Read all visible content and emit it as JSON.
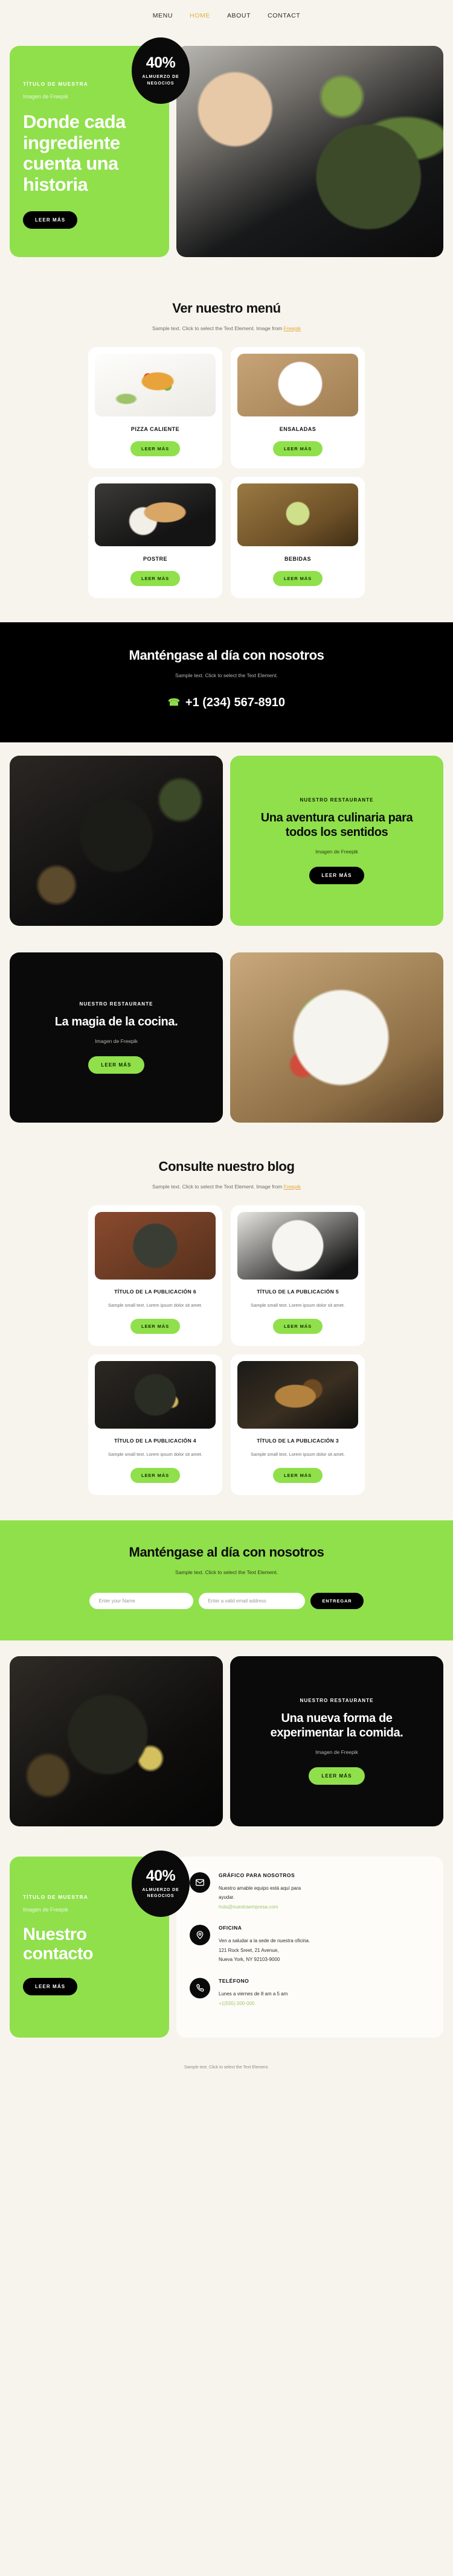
{
  "nav": {
    "items": [
      {
        "label": "MENU",
        "active": false
      },
      {
        "label": "HOME",
        "active": true
      },
      {
        "label": "ABOUT",
        "active": false
      },
      {
        "label": "CONTACT",
        "active": false
      }
    ]
  },
  "colors": {
    "lime": "#8fe04b",
    "black": "#000000",
    "cream": "#f7f4ed",
    "accent_gold": "#e2a93c",
    "accent_green_text": "#9fc765"
  },
  "hero": {
    "eyebrow": "TÍTULO DE MUESTRA",
    "subtitle": "Imagen de Freepik",
    "heading": "Donde cada ingrediente cuenta una historia",
    "button": "LEER MÁS",
    "badge": {
      "percent": "40%",
      "label": "ALMUERZO DE NEGOCIOS"
    }
  },
  "menu_section": {
    "title": "Ver nuestro menú",
    "subtitle_pre": "Sample text. Click to select the Text Element. Image from ",
    "subtitle_link": "Freepik",
    "cards": [
      {
        "title": "PIZZA CALIENTE",
        "button": "LEER MÁS",
        "image": "pizza-photo"
      },
      {
        "title": "ENSALADAS",
        "button": "LEER MÁS",
        "image": "salad-photo"
      },
      {
        "title": "POSTRE",
        "button": "LEER MÁS",
        "image": "dessert-photo"
      },
      {
        "title": "BEBIDAS",
        "button": "LEER MÁS",
        "image": "drinks-photo"
      }
    ]
  },
  "dark_cta": {
    "title": "Manténgase al día con nosotros",
    "subtitle": "Sample text. Click to select the Text Element.",
    "phone": "+1 (234) 567-8910",
    "phone_icon": "phone-icon"
  },
  "feature_one": {
    "image_alt": "dark-bowl-photo",
    "eyebrow": "NUESTRO RESTAURANTE",
    "heading": "Una aventura culinaria para todos los sentidos",
    "note": "Imagen de Freepik",
    "button": "LEER MÁS"
  },
  "feature_two": {
    "eyebrow": "NUESTRO RESTAURANTE",
    "heading": "La magia de la cocina.",
    "note": "Imagen de Freepik",
    "button": "LEER MÁS",
    "image_alt": "salmon-salad-photo"
  },
  "blog_section": {
    "title": "Consulte nuestro blog",
    "subtitle_pre": "Sample text. Click to select the Text Element. Image from ",
    "subtitle_link": "Freepik",
    "posts": [
      {
        "title": "TÍTULO DE LA PUBLICACIÓN 6",
        "text": "Sample small text. Lorem ipsum dolor sit amet.",
        "button": "LEER MÁS",
        "image": "quinoa-salad-photo"
      },
      {
        "title": "TÍTULO DE LA PUBLICACIÓN 5",
        "text": "Sample small text. Lorem ipsum dolor sit amet.",
        "button": "LEER MÁS",
        "image": "strawberry-galette-photo"
      },
      {
        "title": "TÍTULO DE LA PUBLICACIÓN 4",
        "text": "Sample small text. Lorem ipsum dolor sit amet.",
        "button": "LEER MÁS",
        "image": "greens-bowl-photo"
      },
      {
        "title": "TÍTULO DE LA PUBLICACIÓN 3",
        "text": "Sample small text. Lorem ipsum dolor sit amet.",
        "button": "LEER MÁS",
        "image": "bread-photo"
      }
    ]
  },
  "newsletter": {
    "title": "Manténgase al día con nosotros",
    "subtitle": "Sample text. Click to select the Text Element.",
    "name_placeholder": "Enter your Name",
    "name_value": "",
    "email_placeholder": "Enter a valid email address",
    "email_value": "",
    "submit": "ENTREGAR"
  },
  "feature_three": {
    "image_alt": "herbs-bowl-photo",
    "eyebrow": "NUESTRO RESTAURANTE",
    "heading": "Una nueva forma de experimentar la comida.",
    "note": "Imagen de Freepik",
    "button": "LEER MÁS"
  },
  "contact": {
    "eyebrow": "TÍTULO DE MUESTRA",
    "subtitle": "Imagen de Freepik",
    "heading": "Nuestro contacto",
    "button": "LEER MÁS",
    "badge": {
      "percent": "40%",
      "label": "ALMUERZO DE NEGOCIOS"
    },
    "blocks": [
      {
        "icon": "envelope-icon",
        "title": "GRÁFICO PARA NOSOTROS",
        "line1": "Nuestro amable equipo está aquí para",
        "line2": "ayudar.",
        "accent": "hola@nuestraempresa.com"
      },
      {
        "icon": "map-pin-icon",
        "title": "OFICINA",
        "line1": "Ven a saludar a la sede de nuestra oficina.",
        "line2": "121 Rock Sreet, 21 Avenue,",
        "line3": "Nueva York, NY 92103-9000"
      },
      {
        "icon": "phone-icon",
        "title": "TELÉFONO",
        "line1": "Lunes a viernes de 8 am a 5 am",
        "accent": "+1(555) 000-000"
      }
    ]
  },
  "footer": {
    "text": "Sample text. Click to select the Text Element."
  }
}
